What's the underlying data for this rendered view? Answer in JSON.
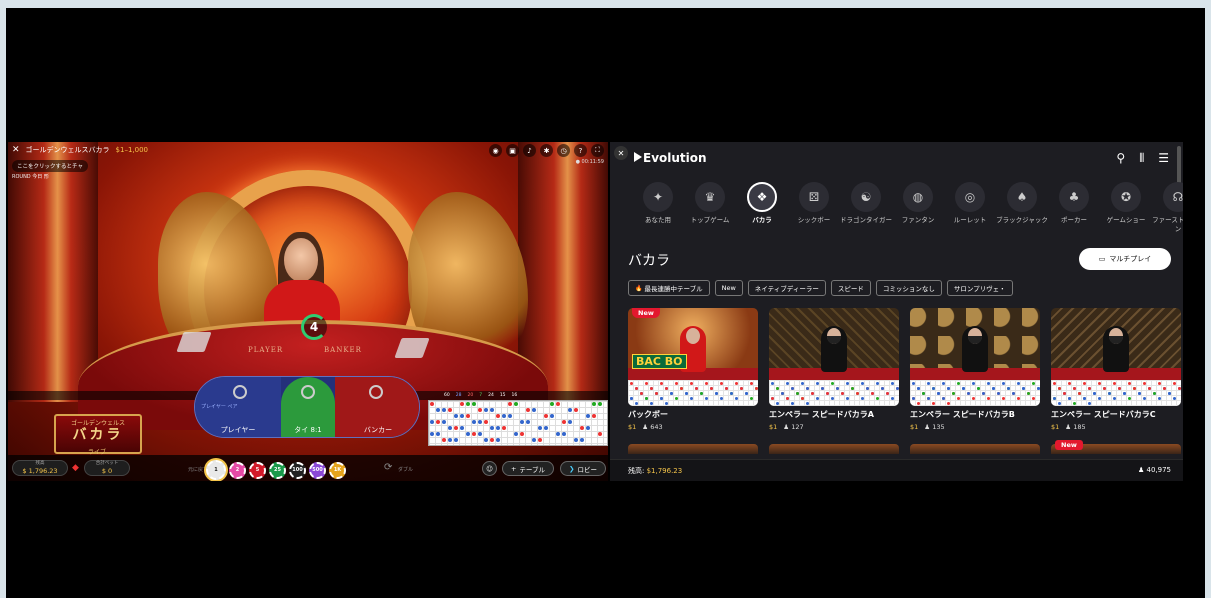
{
  "game": {
    "title": "ゴールデンウェルスバカラ",
    "limit": "$1–1,000",
    "chat_hint": "ここをクリックするとチャ",
    "round_label": "ROUND",
    "round_value": "今日 形",
    "timer": "4",
    "felt_player": "PLAYER",
    "felt_banker": "BANKER",
    "percent": "20%",
    "logo_sub": "ゴールデンウェルス",
    "logo_main": "バカラ",
    "logo_live": "ライブ",
    "bet_player": "プレイヤー",
    "bet_tie": "タイ",
    "bet_tie_ratio": "8:1",
    "bet_banker": "バンカー",
    "player_pair": "プレイヤー ペア",
    "stats": [
      "60",
      "28",
      "20",
      "7",
      "24",
      "15",
      "16"
    ],
    "balance_label": "残高",
    "balance_value": "$ 1,796.23",
    "total_bet_label": "合計ベット",
    "total_bet_value": "$ 0",
    "undo_label": "元に戻す",
    "double_label": "ダブル",
    "chips": [
      {
        "label": "1",
        "color": "#e9e9e9"
      },
      {
        "label": "2",
        "color": "#e64aa6"
      },
      {
        "label": "5",
        "color": "#d21a2a"
      },
      {
        "label": "25",
        "color": "#1a9a4a"
      },
      {
        "label": "100",
        "color": "#222222"
      },
      {
        "label": "500",
        "color": "#8a48d6"
      },
      {
        "label": "1K",
        "color": "#e5a41c"
      }
    ],
    "table_button": "テーブル",
    "lobby_button": "ロビー",
    "clock": "● 00:11:59"
  },
  "lobby": {
    "brand": "Evolution",
    "categories": [
      {
        "label": "あなた用",
        "icon": "✦"
      },
      {
        "label": "トップゲーム",
        "icon": "♛"
      },
      {
        "label": "バカラ",
        "icon": "❖"
      },
      {
        "label": "シックボー",
        "icon": "⚄"
      },
      {
        "label": "ドラゴンタイガー",
        "icon": "☯"
      },
      {
        "label": "ファンタン",
        "icon": "◍"
      },
      {
        "label": "ルーレット",
        "icon": "◎"
      },
      {
        "label": "ブラックジャック",
        "icon": "♠"
      },
      {
        "label": "ポーカー",
        "icon": "♣"
      },
      {
        "label": "ゲームショー",
        "icon": "✪"
      },
      {
        "label": "ファーストパーソン",
        "icon": "☊"
      }
    ],
    "section_title": "バカラ",
    "multiplay": "マルチプレイ",
    "filters": [
      "最長連勝中テーブル",
      "New",
      "ネイティブディーラー",
      "スピード",
      "コミッションなし",
      "サロンプリヴェ・"
    ],
    "cards": [
      {
        "name": "バックボー",
        "min": "$1",
        "players": "643",
        "new": "New",
        "logo": "BAC BO"
      },
      {
        "name": "エンペラー スピードバカラA",
        "min": "$1",
        "players": "127"
      },
      {
        "name": "エンペラー スピードバカラB",
        "min": "$1",
        "players": "135"
      },
      {
        "name": "エンペラー スピードバカラC",
        "min": "$1",
        "players": "185"
      }
    ],
    "row2_new": "New",
    "balance_label": "残高:",
    "balance_value": "$1,796.23",
    "players_total": "40,975"
  }
}
